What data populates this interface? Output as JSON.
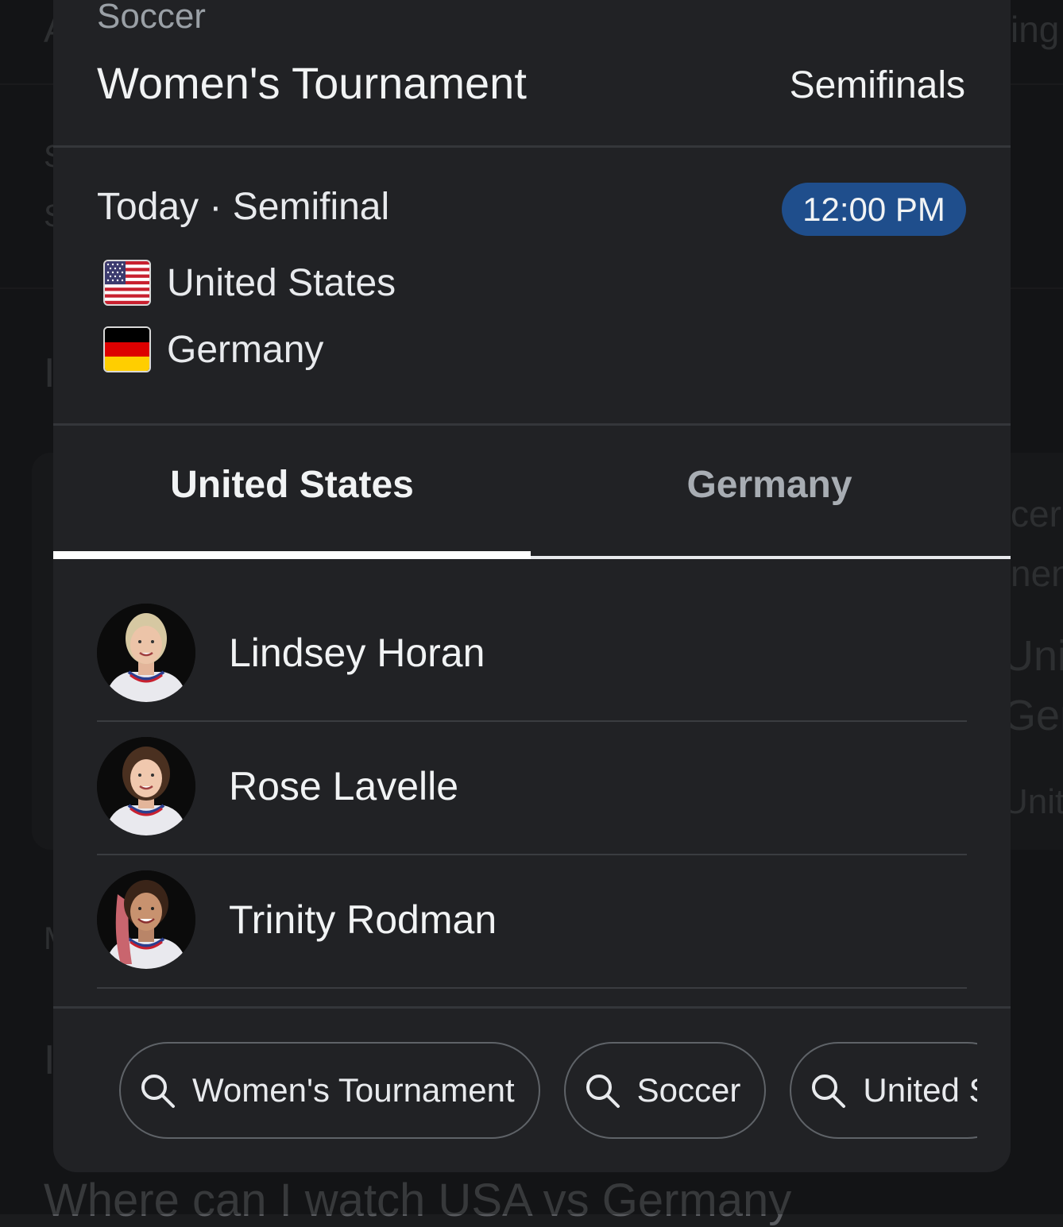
{
  "background": {
    "fragments": [
      "A",
      "ing",
      "S",
      "S",
      "I",
      "cer",
      "nen",
      "Unit",
      "Ger",
      "Unite",
      "M",
      "I"
    ],
    "bottom_text": "Where can I watch USA vs Germany"
  },
  "card": {
    "sport": "Soccer",
    "tournament": "Women's Tournament",
    "round": "Semifinals",
    "match": {
      "when": "Today · Semifinal",
      "time": "12:00 PM",
      "teams": [
        {
          "name": "United States",
          "flag": "us-flag-icon"
        },
        {
          "name": "Germany",
          "flag": "germany-flag-icon"
        }
      ]
    },
    "tabs": [
      {
        "label": "United States",
        "active": true
      },
      {
        "label": "Germany",
        "active": false
      }
    ],
    "players": [
      {
        "name": "Lindsey Horan",
        "hair": "#d6c8a2"
      },
      {
        "name": "Rose Lavelle",
        "hair": "#4a3020"
      },
      {
        "name": "Trinity Rodman",
        "hair": "#c9656e"
      }
    ],
    "related_searches": [
      "Women's Tournament",
      "Soccer",
      "United S"
    ]
  },
  "colors": {
    "card_bg": "#212225",
    "time_pill": "#1f4e8c",
    "text_primary": "#f1f3f4",
    "text_secondary": "#9aa0a6"
  }
}
